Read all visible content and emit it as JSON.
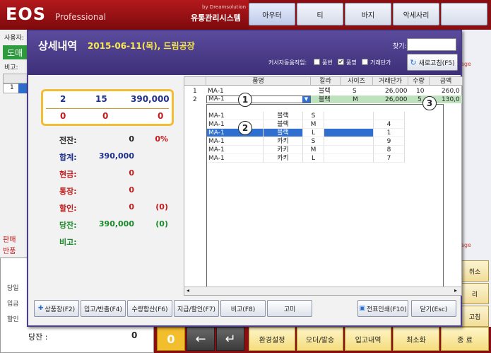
{
  "app": {
    "logo": "EOS",
    "logo_sub": "Professional",
    "by": "by Dreamsolution",
    "system": "유통관리시스템",
    "top_buttons": [
      "아우터",
      "티",
      "바지",
      "악세사리"
    ],
    "user_label": "사용자:",
    "user_value": "도매",
    "note_label": "비고:",
    "grid_row_num": "1",
    "sale_label": "판매",
    "return_label": "반품",
    "left_labels": [
      "당일",
      "입금",
      "할인"
    ],
    "balance_label": "당잔 :",
    "balance_value": "0",
    "right_side": [
      "취소",
      "리",
      "고침"
    ],
    "page_label": "age",
    "bottom_buttons": [
      "환경설정",
      "오더/발송",
      "입고내역",
      "최소화",
      "종 료"
    ],
    "zero_btn": "0",
    "back_btn": "←",
    "enter_btn": "↵"
  },
  "dialog": {
    "title": "상세내역",
    "date": "2015-06-11(목), 드림공장",
    "find_label": "찾기:",
    "auto_label": "커서자동움직임:",
    "checkboxes": [
      {
        "label": "품번",
        "checked": false
      },
      {
        "label": "품명",
        "checked": true
      },
      {
        "label": "거래단가",
        "checked": false
      }
    ],
    "refresh_label": "새로고침(F5)",
    "summary": {
      "row1": [
        "2",
        "15",
        "390,000"
      ],
      "row2": [
        "0",
        "0",
        "0"
      ]
    },
    "totals": [
      {
        "label": "전잔:",
        "value": "0",
        "extra": "0%",
        "color": "#222"
      },
      {
        "label": "합계:",
        "value": "390,000",
        "extra": "",
        "color": "#1e2f8c"
      },
      {
        "label": "현금:",
        "value": "0",
        "extra": "",
        "color": "#c41b1b"
      },
      {
        "label": "통장:",
        "value": "0",
        "extra": "",
        "color": "#c41b1b"
      },
      {
        "label": "할인:",
        "value": "0",
        "extra": "(0)",
        "color": "#c41b1b"
      },
      {
        "label": "당잔:",
        "value": "390,000",
        "extra": "(0)",
        "color": "#1b8a2a"
      },
      {
        "label": "비고:",
        "value": "",
        "extra": "",
        "color": "#1b8a2a"
      }
    ],
    "grid": {
      "headers": [
        "품명",
        "칼라",
        "사이즈",
        "거래단가",
        "수량",
        "금액"
      ],
      "rows": [
        {
          "num": "1",
          "name": "MA-1",
          "color": "블랙",
          "size": "S",
          "price": "26,000",
          "qty": "10",
          "amount": "260,0"
        },
        {
          "num": "2",
          "name": "MA-1",
          "color": "블랙",
          "size": "M",
          "price": "26,000",
          "qty": "5",
          "amount": "130,0"
        }
      ],
      "dropdown": [
        {
          "name": "MA-1",
          "color": "블랙",
          "size": "S",
          "qty": ""
        },
        {
          "name": "MA-1",
          "color": "블랙",
          "size": "M",
          "qty": "4"
        },
        {
          "name": "MA-1",
          "color": "블랙",
          "size": "L",
          "qty": "1"
        },
        {
          "name": "MA-1",
          "color": "카키",
          "size": "S",
          "qty": "9"
        },
        {
          "name": "MA-1",
          "color": "카키",
          "size": "M",
          "qty": "8"
        },
        {
          "name": "MA-1",
          "color": "카키",
          "size": "L",
          "qty": "7"
        }
      ],
      "badges": [
        "1",
        "2",
        "3"
      ]
    },
    "footer_buttons": [
      "상품장(F2)",
      "입고/반출(F4)",
      "수량합산(F6)",
      "지급/할인(F7)",
      "비고(F8)",
      "고미"
    ],
    "print_button": "전표인쇄(F10)",
    "close_button": "닫기(Esc)"
  }
}
